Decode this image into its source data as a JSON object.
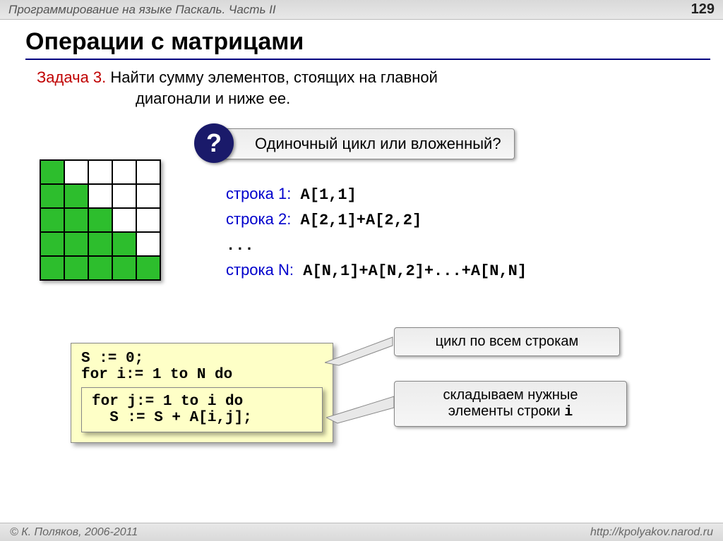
{
  "header": {
    "left": "Программирование на языке Паскаль. Часть II",
    "page": "129"
  },
  "title": "Операции с матрицами",
  "task": {
    "label": "Задача 3.",
    "line1": " Найти сумму элементов, стоящих  на главной",
    "line2": "диагонали и ниже ее."
  },
  "question": "Одиночный цикл или вложенный?",
  "question_mark": "?",
  "rows": {
    "r1_label": "строка 1:",
    "r1_code": " A[1,1]",
    "r2_label": "строка 2:",
    "r2_code": " A[2,1]+A[2,2]",
    "dots": "...",
    "rn_label": "строка N:",
    "rn_code": " A[N,1]+A[N,2]+...+A[N,N]"
  },
  "code": {
    "outer_l1": "S := 0;",
    "outer_l2": "for i:= 1 to N do",
    "inner_l1": "for j:= 1 to i do",
    "inner_l2": "  S := S + A[i,j];"
  },
  "notes": {
    "n1": "цикл по всем строкам",
    "n2a": "складываем нужные",
    "n2b": "элементы строки ",
    "n2c": "i"
  },
  "footer": {
    "left": "© К. Поляков, 2006-2011",
    "right": "http://kpolyakov.narod.ru"
  },
  "matrix": {
    "size": 5,
    "description": "5x5 grid, cells on and below main diagonal are green"
  }
}
